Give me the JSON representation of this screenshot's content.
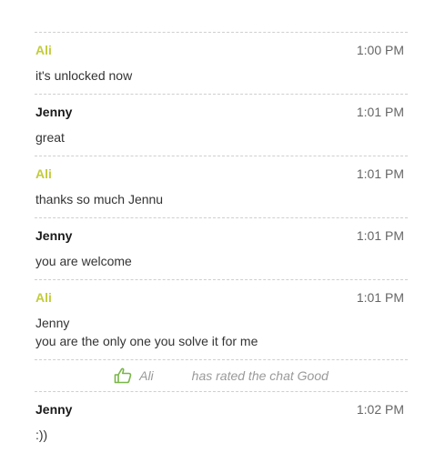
{
  "colors": {
    "ali": "#c2cc3c",
    "jenny": "#1a1a1a",
    "rating_icon": "#7ab648",
    "divider": "#cfcfcf"
  },
  "messages": [
    {
      "sender": "Ali",
      "time": "1:00 PM",
      "lines": [
        "it's unlocked now"
      ]
    },
    {
      "sender": "Jenny",
      "time": "1:01 PM",
      "lines": [
        "great"
      ]
    },
    {
      "sender": "Ali",
      "time": "1:01 PM",
      "lines": [
        "thanks so much Jennu"
      ]
    },
    {
      "sender": "Jenny",
      "time": "1:01 PM",
      "lines": [
        "you are welcome"
      ]
    },
    {
      "sender": "Ali",
      "time": "1:01 PM",
      "lines": [
        "Jenny",
        "you are the only one you solve it for me"
      ]
    }
  ],
  "rating": {
    "icon": "thumbs-up-icon",
    "name": "Ali",
    "text": "has rated the chat Good"
  },
  "last_message": {
    "sender": "Jenny",
    "time": "1:02 PM",
    "lines": [
      ":))"
    ]
  }
}
